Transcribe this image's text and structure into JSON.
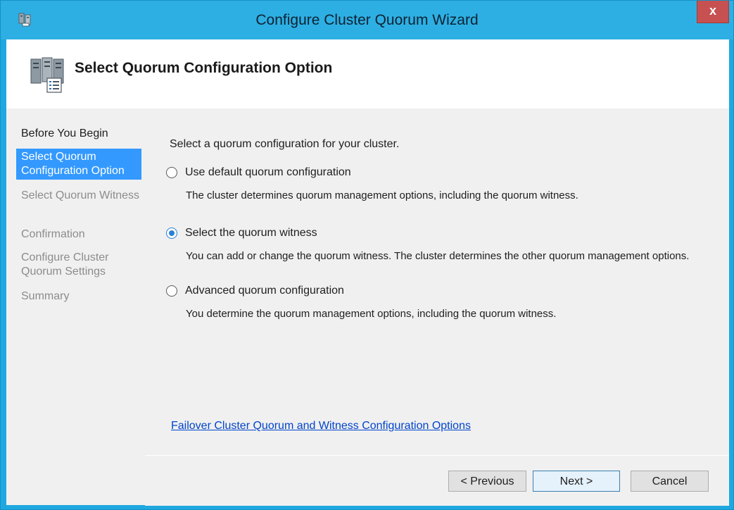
{
  "window": {
    "title": "Configure Cluster Quorum Wizard",
    "app_icon": "cluster-wizard-icon",
    "close_label": "x"
  },
  "header": {
    "title": "Select Quorum Configuration Option",
    "icon": "cluster-servers-icon"
  },
  "sidebar": {
    "items": [
      {
        "label": "Before You Begin",
        "state": "done"
      },
      {
        "label": "Select Quorum Configuration Option",
        "state": "current"
      },
      {
        "label": "Select Quorum Witness",
        "state": "pending"
      },
      {
        "label": "Confirmation",
        "state": "pending"
      },
      {
        "label": "Configure Cluster Quorum Settings",
        "state": "pending"
      },
      {
        "label": "Summary",
        "state": "pending"
      }
    ]
  },
  "main": {
    "intro": "Select a quorum configuration for your cluster.",
    "options": [
      {
        "label": "Use default quorum configuration",
        "description": "The cluster determines quorum management options, including the quorum witness.",
        "selected": false
      },
      {
        "label": "Select the quorum witness",
        "description": "You can add or change the quorum witness. The cluster determines the other quorum management options.",
        "selected": true
      },
      {
        "label": "Advanced quorum configuration",
        "description": "You determine the quorum management options, including the quorum witness.",
        "selected": false
      }
    ],
    "help_link": "Failover Cluster Quorum and Witness Configuration Options"
  },
  "footer": {
    "previous_label": "< Previous",
    "next_label": "Next >",
    "cancel_label": "Cancel"
  },
  "colors": {
    "title_bar": "#2dafe4",
    "selected_nav": "#3399ff",
    "close_button": "#c75050",
    "link": "#0044cc"
  }
}
